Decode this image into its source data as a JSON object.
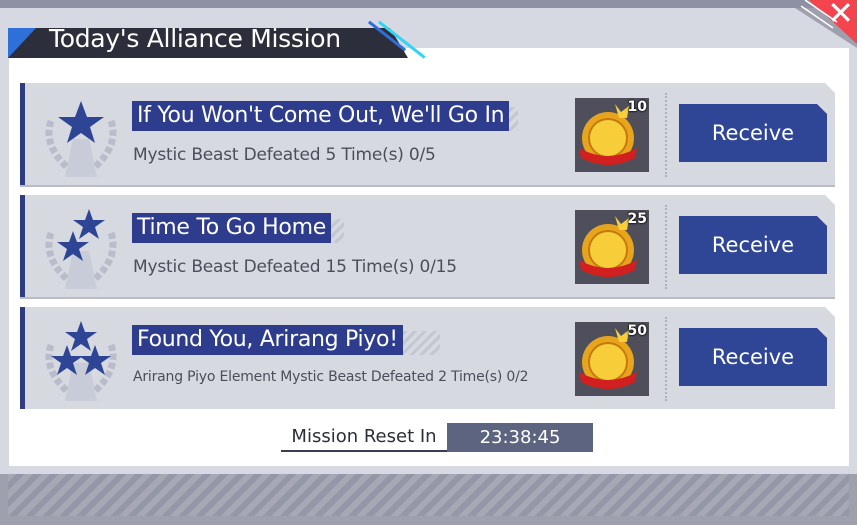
{
  "header": {
    "title": "Today's Alliance Mission"
  },
  "close": {
    "icon": "close-icon",
    "color": "#f4444d"
  },
  "missions": [
    {
      "title": "If You Won't Come Out, We'll Go In",
      "description": "Mystic Beast Defeated 5 Time(s) 0/5",
      "reward_count": "10",
      "button": "Receive",
      "stars": 1
    },
    {
      "title": "Time To Go Home",
      "description": "Mystic Beast Defeated 15 Time(s) 0/15",
      "reward_count": "25",
      "button": "Receive",
      "stars": 2
    },
    {
      "title": "Found You, Arirang Piyo!",
      "description": "Arirang Piyo Element Mystic Beast Defeated 2 Time(s) 0/2",
      "reward_count": "50",
      "button": "Receive",
      "stars": 3
    }
  ],
  "reset": {
    "label": "Mission Reset In",
    "time": "23:38:45"
  },
  "colors": {
    "accent": "#2e3c8e",
    "button": "#2f4596",
    "header": "#2c2f3b",
    "header_accent": "#2f6fd9"
  }
}
